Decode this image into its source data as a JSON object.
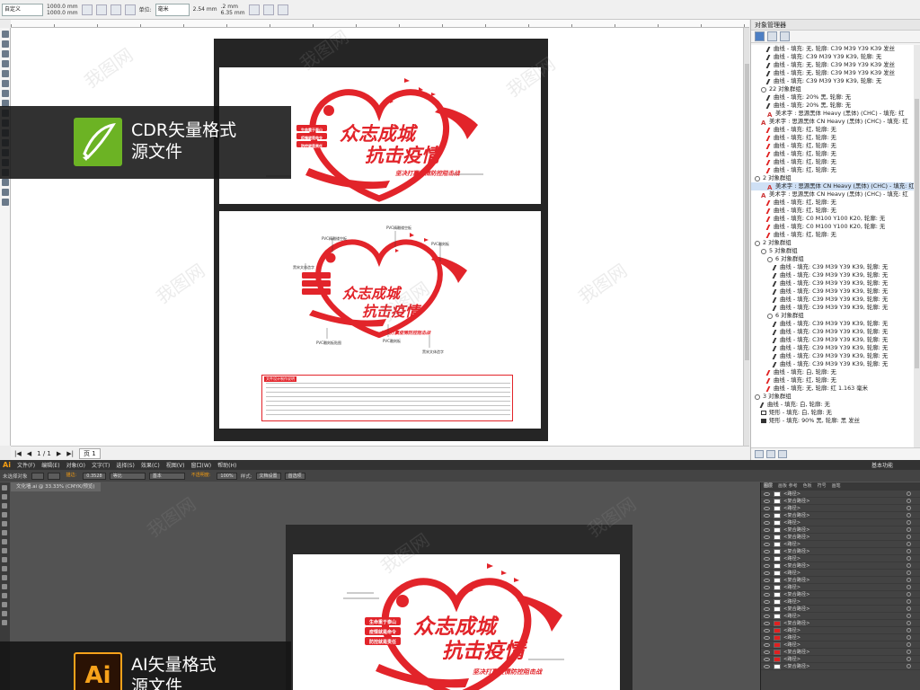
{
  "cdr": {
    "toolbar": {
      "preset": "自定义",
      "width": "1000.0 mm",
      "height": "1000.0 mm",
      "units_label": "单位:",
      "units": "毫米",
      "nudge": "2.54 mm",
      "dup_x": ".2 mm",
      "dup_y": "6.35 mm",
      "zoom": "119%"
    },
    "ruler_ticks": [
      "100",
      "200",
      "300",
      "400",
      "500",
      "600",
      "700",
      "800",
      "900",
      "1000"
    ],
    "status": {
      "pages": "1 / 1",
      "page_tab": "页 1"
    },
    "design": {
      "title_line1": "众志成城",
      "title_line2": "抗击疫情",
      "subtitle": "坚决打赢疫情防控阻击战",
      "tag1": "生命重于泰山",
      "tag2": "疫情就是命令",
      "tag3": "防控就是责任"
    },
    "callouts": [
      "PVC精雕镂空板",
      "PVC精雕镂空板",
      "PVC雕刻板",
      "黑宋文体造字",
      "PVC雕刻板贴图",
      "PVC雕刻板",
      "黑宋文体造字",
      "黑宋文体造字"
    ],
    "spec_title": "文件设计制作说明",
    "panel": {
      "title": "对象管理器",
      "items": [
        {
          "type": "curve",
          "indent": 2,
          "text": "曲线 - 填充: 无, 轮廓: C39 M39 Y39 K39 发丝"
        },
        {
          "type": "curve",
          "indent": 2,
          "text": "曲线 - 填充: C39 M39 Y39 K39, 轮廓: 无"
        },
        {
          "type": "curve",
          "indent": 2,
          "text": "曲线 - 填充: 无, 轮廓: C39 M39 Y39 K39 发丝"
        },
        {
          "type": "curve",
          "indent": 2,
          "text": "曲线 - 填充: 无, 轮廓: C39 M39 Y39 K39 发丝"
        },
        {
          "type": "curve",
          "indent": 2,
          "text": "曲线 - 填充: C39 M39 Y39 K39, 轮廓: 无"
        },
        {
          "type": "group",
          "indent": 1,
          "text": "22 对象群组"
        },
        {
          "type": "curve",
          "indent": 2,
          "text": "曲线 - 填充: 20% 黑, 轮廓: 无"
        },
        {
          "type": "curve",
          "indent": 2,
          "text": "曲线 - 填充: 20% 黑, 轮廓: 无"
        },
        {
          "type": "text",
          "indent": 2,
          "text": "美术字 : 思源黑体 Heavy (黑体) (CHC) - 填充: 红"
        },
        {
          "type": "text",
          "indent": 1,
          "text": "美术字 : 思源黑体 CN Heavy (黑体) (CHC) - 填充: 红"
        },
        {
          "type": "curve-red",
          "indent": 2,
          "text": "曲线 - 填充: 红, 轮廓: 无"
        },
        {
          "type": "curve-red",
          "indent": 2,
          "text": "曲线 - 填充: 红, 轮廓: 无"
        },
        {
          "type": "curve-red",
          "indent": 2,
          "text": "曲线 - 填充: 红, 轮廓: 无"
        },
        {
          "type": "curve-red",
          "indent": 2,
          "text": "曲线 - 填充: 红, 轮廓: 无"
        },
        {
          "type": "curve-red",
          "indent": 2,
          "text": "曲线 - 填充: 红, 轮廓: 无"
        },
        {
          "type": "curve-red",
          "indent": 2,
          "text": "曲线 - 填充: 红, 轮廓: 无"
        },
        {
          "type": "group",
          "indent": 0,
          "text": "2 对象群组"
        },
        {
          "type": "text",
          "indent": 2,
          "text": "美术字 : 思源黑体 CN Heavy (黑体) (CHC) - 填充: 红",
          "selected": true
        },
        {
          "type": "text",
          "indent": 1,
          "text": "美术字 : 思源黑体 CN Heavy (黑体) (CHC) - 填充: 红"
        },
        {
          "type": "curve-red",
          "indent": 2,
          "text": "曲线 - 填充: 红, 轮廓: 无"
        },
        {
          "type": "curve-red",
          "indent": 2,
          "text": "曲线 - 填充: 红, 轮廓: 无"
        },
        {
          "type": "curve-red",
          "indent": 2,
          "text": "曲线 - 填充: C0 M100 Y100 K20, 轮廓: 无"
        },
        {
          "type": "curve-red",
          "indent": 2,
          "text": "曲线 - 填充: C0 M100 Y100 K20, 轮廓: 无"
        },
        {
          "type": "curve-red",
          "indent": 2,
          "text": "曲线 - 填充: 红, 轮廓: 无"
        },
        {
          "type": "group",
          "indent": 0,
          "text": "2 对象群组"
        },
        {
          "type": "group",
          "indent": 1,
          "text": "5 对象群组"
        },
        {
          "type": "group",
          "indent": 2,
          "text": "6 对象群组"
        },
        {
          "type": "curve",
          "indent": 3,
          "text": "曲线 - 填充: C39 M39 Y39 K39, 轮廓: 无"
        },
        {
          "type": "curve",
          "indent": 3,
          "text": "曲线 - 填充: C39 M39 Y39 K39, 轮廓: 无"
        },
        {
          "type": "curve",
          "indent": 3,
          "text": "曲线 - 填充: C39 M39 Y39 K39, 轮廓: 无"
        },
        {
          "type": "curve",
          "indent": 3,
          "text": "曲线 - 填充: C39 M39 Y39 K39, 轮廓: 无"
        },
        {
          "type": "curve",
          "indent": 3,
          "text": "曲线 - 填充: C39 M39 Y39 K39, 轮廓: 无"
        },
        {
          "type": "curve",
          "indent": 3,
          "text": "曲线 - 填充: C39 M39 Y39 K39, 轮廓: 无"
        },
        {
          "type": "group",
          "indent": 2,
          "text": "6 对象群组"
        },
        {
          "type": "curve",
          "indent": 3,
          "text": "曲线 - 填充: C39 M39 Y39 K39, 轮廓: 无"
        },
        {
          "type": "curve",
          "indent": 3,
          "text": "曲线 - 填充: C39 M39 Y39 K39, 轮廓: 无"
        },
        {
          "type": "curve",
          "indent": 3,
          "text": "曲线 - 填充: C39 M39 Y39 K39, 轮廓: 无"
        },
        {
          "type": "curve",
          "indent": 3,
          "text": "曲线 - 填充: C39 M39 Y39 K39, 轮廓: 无"
        },
        {
          "type": "curve",
          "indent": 3,
          "text": "曲线 - 填充: C39 M39 Y39 K39, 轮廓: 无"
        },
        {
          "type": "curve",
          "indent": 3,
          "text": "曲线 - 填充: C39 M39 Y39 K39, 轮廓: 无"
        },
        {
          "type": "curve-red",
          "indent": 2,
          "text": "曲线 - 填充: 白, 轮廓: 无"
        },
        {
          "type": "curve-red",
          "indent": 2,
          "text": "曲线 - 填充: 红, 轮廓: 无"
        },
        {
          "type": "curve-red",
          "indent": 2,
          "text": "曲线 - 填充: 无, 轮廓: 红 1.163 毫米"
        },
        {
          "type": "group",
          "indent": 0,
          "text": "3 对象群组"
        },
        {
          "type": "curve",
          "indent": 1,
          "text": "曲线 - 填充: 白, 轮廓: 无"
        },
        {
          "type": "rect",
          "indent": 1,
          "text": "矩形 - 填充: 白, 轮廓: 无"
        },
        {
          "type": "rect-filled",
          "indent": 1,
          "text": "矩形 - 填充: 90% 黑, 轮廓: 黑 发丝"
        }
      ]
    }
  },
  "ai": {
    "logo": "Ai",
    "menus": [
      "文件(F)",
      "编辑(E)",
      "对象(O)",
      "文字(T)",
      "选择(S)",
      "效果(C)",
      "视图(V)",
      "窗口(W)",
      "帮助(H)"
    ],
    "workspace": "基本功能",
    "control": {
      "selection": "未选择对象",
      "stroke_label": "描边:",
      "stroke_value": "0.3528",
      "profile1": "等比",
      "profile2": "基本",
      "opacity_label": "不透明度:",
      "opacity": "100%",
      "style_label": "样式:",
      "doc_setup": "文档设置",
      "prefs": "首选项"
    },
    "doc_tab": "文化墙.ai @ 33.33% (CMYK/预览)",
    "layer_tabs": [
      "图层",
      "画板 参考",
      "色板",
      "符号",
      "画笔"
    ],
    "layers": [
      {
        "name": "<路径>",
        "thumb": "white"
      },
      {
        "name": "<复合路径>",
        "thumb": "white"
      },
      {
        "name": "<路径>",
        "thumb": "white"
      },
      {
        "name": "<复合路径>",
        "thumb": "white"
      },
      {
        "name": "<路径>",
        "thumb": "white"
      },
      {
        "name": "<复合路径>",
        "thumb": "white"
      },
      {
        "name": "<复合路径>",
        "thumb": "white"
      },
      {
        "name": "<路径>",
        "thumb": "white"
      },
      {
        "name": "<复合路径>",
        "thumb": "white"
      },
      {
        "name": "<路径>",
        "thumb": "white"
      },
      {
        "name": "<复合路径>",
        "thumb": "white"
      },
      {
        "name": "<路径>",
        "thumb": "white"
      },
      {
        "name": "<复合路径>",
        "thumb": "white"
      },
      {
        "name": "<路径>",
        "thumb": "white"
      },
      {
        "name": "<复合路径>",
        "thumb": "white"
      },
      {
        "name": "<路径>",
        "thumb": "white"
      },
      {
        "name": "<复合路径>",
        "thumb": "white"
      },
      {
        "name": "<路径>",
        "thumb": "white"
      },
      {
        "name": "<复合路径>",
        "thumb": "red"
      },
      {
        "name": "<路径>",
        "thumb": "red"
      },
      {
        "name": "<路径>",
        "thumb": "red"
      },
      {
        "name": "<路径>",
        "thumb": "red"
      },
      {
        "name": "<复合路径>",
        "thumb": "red"
      },
      {
        "name": "<路径>",
        "thumb": "red"
      },
      {
        "name": "<复合路径>",
        "thumb": "white"
      }
    ]
  },
  "banners": {
    "cdr_line1": "CDR矢量格式",
    "cdr_line2": "源文件",
    "ai_line1": "AI矢量格式",
    "ai_line2": "源文件"
  },
  "watermark": "我图网",
  "colors": {
    "brand_red": "#e2242a",
    "cdr_green": "#6cb324",
    "ai_orange": "#f7a21b"
  }
}
